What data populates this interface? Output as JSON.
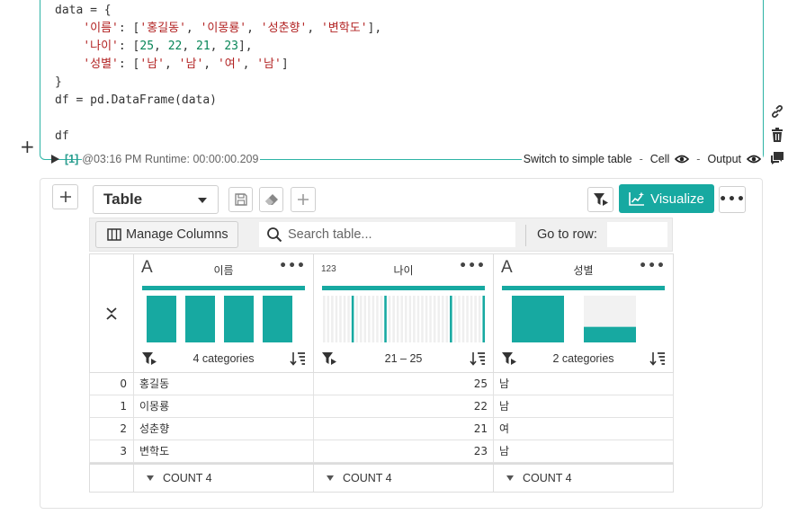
{
  "code": {
    "lines": [
      "data = {",
      "    '이름': ['홍길동', '이몽룡', '성춘향', '변학도'],",
      "    '나이': [25, 22, 21, 23],",
      "    '성별': ['남', '남', '여', '남']",
      "}",
      "df = pd.DataFrame(data)",
      "",
      "df"
    ]
  },
  "cell_footer": {
    "exec_count": "[1]",
    "meta": "@03:16 PM Runtime: 00:00:00.209",
    "switch_label": "Switch to simple table",
    "cell_label": "Cell",
    "output_label": "Output",
    "separator": "-"
  },
  "toolbar": {
    "view_select": "Table",
    "visualize_label": "Visualize"
  },
  "grid_toolbar": {
    "manage_columns": "Manage Columns",
    "search_placeholder": "Search table...",
    "goto_label": "Go to row:"
  },
  "columns": [
    {
      "name": "이름",
      "type_icon": "A",
      "summary": "4 categories",
      "histogram": [
        1,
        1,
        1,
        1
      ]
    },
    {
      "name": "나이",
      "type_icon": "123",
      "summary": "21 – 25",
      "histogram": [
        0,
        0,
        0,
        0,
        0,
        0,
        0,
        1,
        0,
        0,
        0,
        0,
        0,
        0,
        0,
        1,
        0,
        0,
        0,
        0,
        0,
        0,
        0,
        0,
        0,
        0,
        0,
        0,
        0,
        0,
        0,
        1,
        0,
        0,
        0,
        0,
        0,
        0,
        0,
        1
      ]
    },
    {
      "name": "성별",
      "type_icon": "A",
      "summary": "2 categories",
      "histogram": [
        3,
        1
      ]
    }
  ],
  "rows": [
    {
      "index": "0",
      "name": "홍길동",
      "age": "25",
      "gender": "남"
    },
    {
      "index": "1",
      "name": "이몽룡",
      "age": "22",
      "gender": "남"
    },
    {
      "index": "2",
      "name": "성춘향",
      "age": "21",
      "gender": "여"
    },
    {
      "index": "3",
      "name": "변학도",
      "age": "23",
      "gender": "남"
    }
  ],
  "footer": [
    {
      "label": "COUNT 4"
    },
    {
      "label": "COUNT 4"
    },
    {
      "label": "COUNT 4"
    }
  ],
  "colors": {
    "accent": "#17a9a1",
    "cell_border": "#2db3a5"
  }
}
